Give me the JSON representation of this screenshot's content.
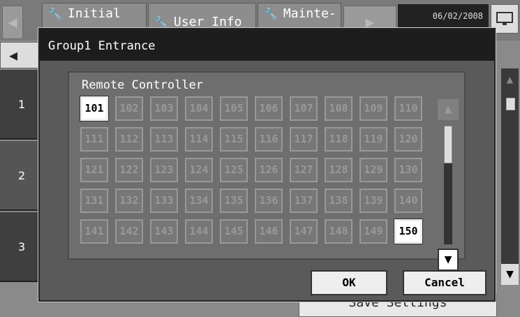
{
  "background": {
    "tabs": [
      {
        "label": "Initial"
      },
      {
        "label": "User Info"
      },
      {
        "label": "Mainte-"
      }
    ],
    "date": "06/02/2008",
    "side_items": [
      "1",
      "2",
      "3"
    ],
    "save_label": "Save Settings"
  },
  "dialog": {
    "title": "Group1 Entrance",
    "panel_label": "Remote Controller",
    "controllers": [
      "101",
      "102",
      "103",
      "104",
      "105",
      "106",
      "107",
      "108",
      "109",
      "110",
      "111",
      "112",
      "113",
      "114",
      "115",
      "116",
      "117",
      "118",
      "119",
      "120",
      "121",
      "122",
      "123",
      "124",
      "125",
      "126",
      "127",
      "128",
      "129",
      "130",
      "131",
      "132",
      "133",
      "134",
      "135",
      "136",
      "137",
      "138",
      "139",
      "140",
      "141",
      "142",
      "143",
      "144",
      "145",
      "146",
      "147",
      "148",
      "149",
      "150"
    ],
    "active": [
      "101",
      "150"
    ],
    "ok_label": "OK",
    "cancel_label": "Cancel"
  },
  "colors": {
    "title_bar": "#1d1d1d",
    "dialog_bg": "#5a5a5a",
    "active_cell": "#ffffff",
    "inactive_cell": "#777777"
  }
}
